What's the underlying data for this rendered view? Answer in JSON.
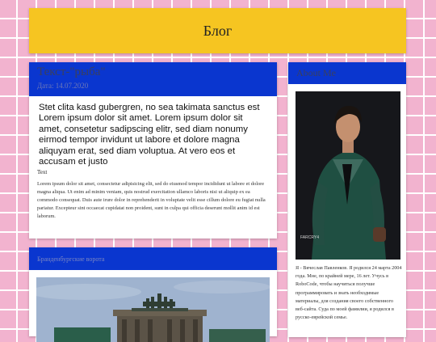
{
  "header": {
    "title": "Блог"
  },
  "post1": {
    "title": "Текст-\"рыба\"",
    "date": "Дата: 14.07.2020",
    "lead": "Stet clita kasd gubergren, no sea takimata sanctus est Lorem ipsum dolor sit amet. Lorem ipsum dolor sit amet, consetetur sadipscing elitr, sed diam nonumy eirmod tempor invidunt ut labore et dolore magna aliquyam erat, sed diam voluptua. At vero eos et accusam et justo",
    "label": "Text",
    "body": "Lorem ipsum dolor sit amet, consectetur adipisicing elit, sed do eiusmod tempor incididunt ut labore et dolore magna aliqua. Ut enim ad minim veniam, quis nostrud exercitation ullamco laboris nisi ut aliquip ex ea commodo consequat. Duis aute irure dolor in reprehenderit in voluptate velit esse cillum dolore eu fugiat nulla pariatur. Excepteur sint occaecat cupidatat non proident, sunt in culpa qui officia deserunt mollit anim id est laborum."
  },
  "post2": {
    "title": "Бранденбургские ворота"
  },
  "about": {
    "title": "About Me",
    "bio": "Я - Вячеслав Павленков. Я родился 24 марта 2004 года. Мне, по крайней мере, 16 лет. Учусь в RoboCode, чтобы научиться получше программировать и знать необходимые материалы, для создания своего собственного веб-сайта. Суда по моей фамилии, я родился в русско-еврейской семье.",
    "watermark": "FARCRY4"
  }
}
